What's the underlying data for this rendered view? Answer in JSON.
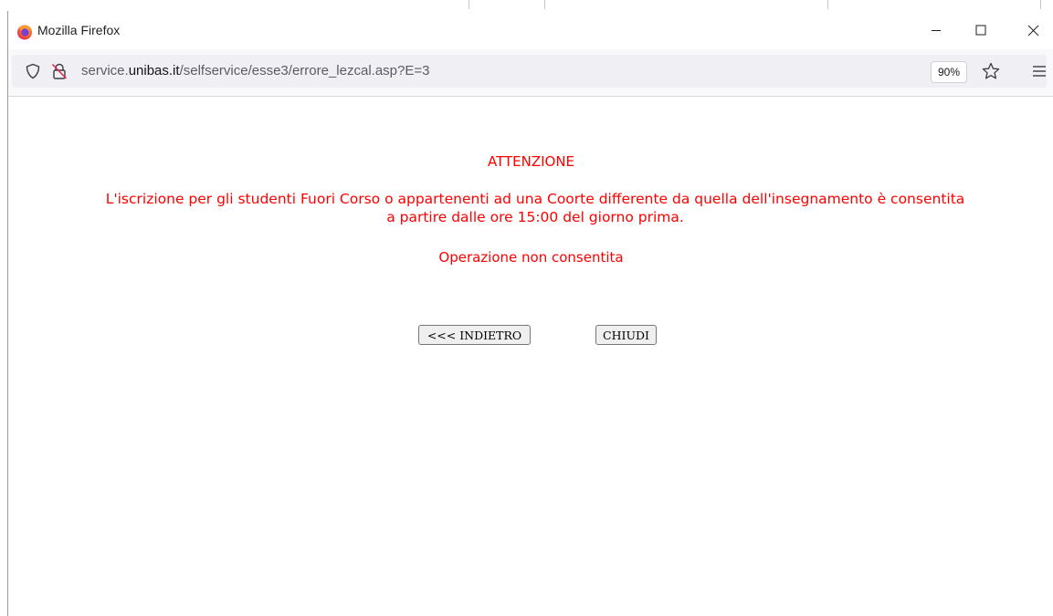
{
  "window": {
    "title": "Mozilla Firefox",
    "icon": "firefox-icon",
    "controls": {
      "minimize_icon": "minimize-icon",
      "maximize_icon": "maximize-icon",
      "close_icon": "close-icon"
    }
  },
  "urlbar": {
    "url_prefix": "service.",
    "url_domain": "unibas.it",
    "url_path": "/selfservice/esse3/errore_lezcal.asp?E=3",
    "zoom": "90%",
    "shield_icon": "shield-icon",
    "lock_icon": "insecure-lock-icon",
    "star_icon": "bookmark-star-icon",
    "menu_icon": "hamburger-menu-icon"
  },
  "page": {
    "heading": "ATTENZIONE",
    "message_line1": "L'iscrizione per gli studenti Fuori Corso o appartenenti ad una Coorte differente da quella dell'insegnamento è consentita",
    "message_line2": "a partire dalle ore 15:00 del giorno prima.",
    "status": "Operazione non consentita",
    "back_button": "<<< INDIETRO",
    "close_button": "CHIUDI",
    "text_color": "#ff0000"
  }
}
